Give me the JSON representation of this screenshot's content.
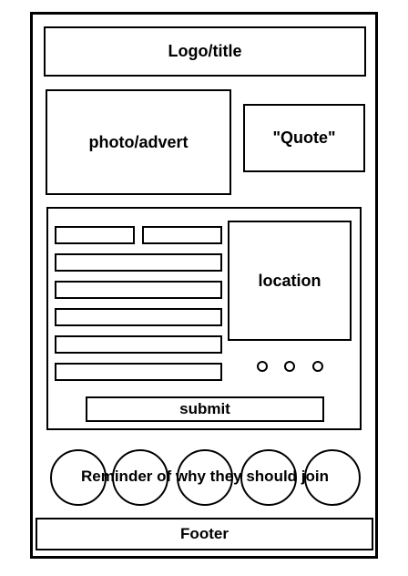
{
  "header": {
    "title": "Logo/title"
  },
  "photo": {
    "label": "photo/advert"
  },
  "quote": {
    "label": "\"Quote\""
  },
  "form": {
    "location_label": "location",
    "submit_label": "submit"
  },
  "reminder": {
    "text": "Reminder of why they should join"
  },
  "footer": {
    "label": "Footer"
  }
}
